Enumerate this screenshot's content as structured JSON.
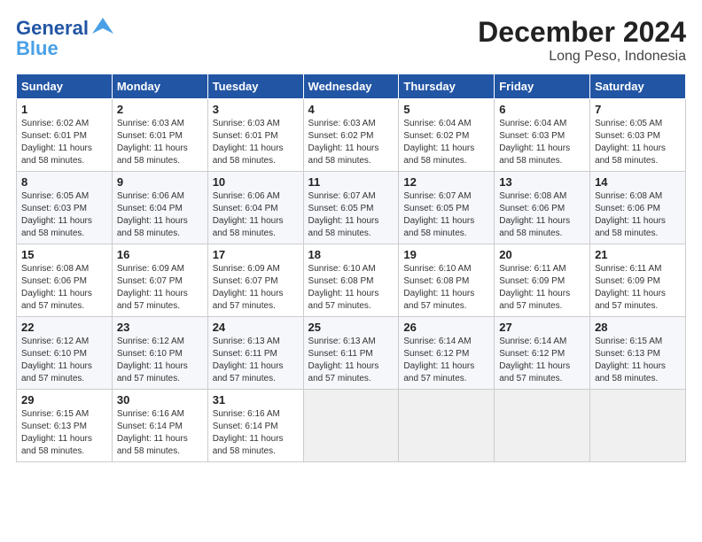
{
  "logo": {
    "line1": "General",
    "line2": "Blue",
    "bird": "▲"
  },
  "title": "December 2024",
  "subtitle": "Long Peso, Indonesia",
  "columns": [
    "Sunday",
    "Monday",
    "Tuesday",
    "Wednesday",
    "Thursday",
    "Friday",
    "Saturday"
  ],
  "weeks": [
    [
      {
        "day": "1",
        "detail": "Sunrise: 6:02 AM\nSunset: 6:01 PM\nDaylight: 11 hours\nand 58 minutes."
      },
      {
        "day": "2",
        "detail": "Sunrise: 6:03 AM\nSunset: 6:01 PM\nDaylight: 11 hours\nand 58 minutes."
      },
      {
        "day": "3",
        "detail": "Sunrise: 6:03 AM\nSunset: 6:01 PM\nDaylight: 11 hours\nand 58 minutes."
      },
      {
        "day": "4",
        "detail": "Sunrise: 6:03 AM\nSunset: 6:02 PM\nDaylight: 11 hours\nand 58 minutes."
      },
      {
        "day": "5",
        "detail": "Sunrise: 6:04 AM\nSunset: 6:02 PM\nDaylight: 11 hours\nand 58 minutes."
      },
      {
        "day": "6",
        "detail": "Sunrise: 6:04 AM\nSunset: 6:03 PM\nDaylight: 11 hours\nand 58 minutes."
      },
      {
        "day": "7",
        "detail": "Sunrise: 6:05 AM\nSunset: 6:03 PM\nDaylight: 11 hours\nand 58 minutes."
      }
    ],
    [
      {
        "day": "8",
        "detail": "Sunrise: 6:05 AM\nSunset: 6:03 PM\nDaylight: 11 hours\nand 58 minutes."
      },
      {
        "day": "9",
        "detail": "Sunrise: 6:06 AM\nSunset: 6:04 PM\nDaylight: 11 hours\nand 58 minutes."
      },
      {
        "day": "10",
        "detail": "Sunrise: 6:06 AM\nSunset: 6:04 PM\nDaylight: 11 hours\nand 58 minutes."
      },
      {
        "day": "11",
        "detail": "Sunrise: 6:07 AM\nSunset: 6:05 PM\nDaylight: 11 hours\nand 58 minutes."
      },
      {
        "day": "12",
        "detail": "Sunrise: 6:07 AM\nSunset: 6:05 PM\nDaylight: 11 hours\nand 58 minutes."
      },
      {
        "day": "13",
        "detail": "Sunrise: 6:08 AM\nSunset: 6:06 PM\nDaylight: 11 hours\nand 58 minutes."
      },
      {
        "day": "14",
        "detail": "Sunrise: 6:08 AM\nSunset: 6:06 PM\nDaylight: 11 hours\nand 58 minutes."
      }
    ],
    [
      {
        "day": "15",
        "detail": "Sunrise: 6:08 AM\nSunset: 6:06 PM\nDaylight: 11 hours\nand 57 minutes."
      },
      {
        "day": "16",
        "detail": "Sunrise: 6:09 AM\nSunset: 6:07 PM\nDaylight: 11 hours\nand 57 minutes."
      },
      {
        "day": "17",
        "detail": "Sunrise: 6:09 AM\nSunset: 6:07 PM\nDaylight: 11 hours\nand 57 minutes."
      },
      {
        "day": "18",
        "detail": "Sunrise: 6:10 AM\nSunset: 6:08 PM\nDaylight: 11 hours\nand 57 minutes."
      },
      {
        "day": "19",
        "detail": "Sunrise: 6:10 AM\nSunset: 6:08 PM\nDaylight: 11 hours\nand 57 minutes."
      },
      {
        "day": "20",
        "detail": "Sunrise: 6:11 AM\nSunset: 6:09 PM\nDaylight: 11 hours\nand 57 minutes."
      },
      {
        "day": "21",
        "detail": "Sunrise: 6:11 AM\nSunset: 6:09 PM\nDaylight: 11 hours\nand 57 minutes."
      }
    ],
    [
      {
        "day": "22",
        "detail": "Sunrise: 6:12 AM\nSunset: 6:10 PM\nDaylight: 11 hours\nand 57 minutes."
      },
      {
        "day": "23",
        "detail": "Sunrise: 6:12 AM\nSunset: 6:10 PM\nDaylight: 11 hours\nand 57 minutes."
      },
      {
        "day": "24",
        "detail": "Sunrise: 6:13 AM\nSunset: 6:11 PM\nDaylight: 11 hours\nand 57 minutes."
      },
      {
        "day": "25",
        "detail": "Sunrise: 6:13 AM\nSunset: 6:11 PM\nDaylight: 11 hours\nand 57 minutes."
      },
      {
        "day": "26",
        "detail": "Sunrise: 6:14 AM\nSunset: 6:12 PM\nDaylight: 11 hours\nand 57 minutes."
      },
      {
        "day": "27",
        "detail": "Sunrise: 6:14 AM\nSunset: 6:12 PM\nDaylight: 11 hours\nand 57 minutes."
      },
      {
        "day": "28",
        "detail": "Sunrise: 6:15 AM\nSunset: 6:13 PM\nDaylight: 11 hours\nand 58 minutes."
      }
    ],
    [
      {
        "day": "29",
        "detail": "Sunrise: 6:15 AM\nSunset: 6:13 PM\nDaylight: 11 hours\nand 58 minutes."
      },
      {
        "day": "30",
        "detail": "Sunrise: 6:16 AM\nSunset: 6:14 PM\nDaylight: 11 hours\nand 58 minutes."
      },
      {
        "day": "31",
        "detail": "Sunrise: 6:16 AM\nSunset: 6:14 PM\nDaylight: 11 hours\nand 58 minutes."
      },
      null,
      null,
      null,
      null
    ]
  ]
}
